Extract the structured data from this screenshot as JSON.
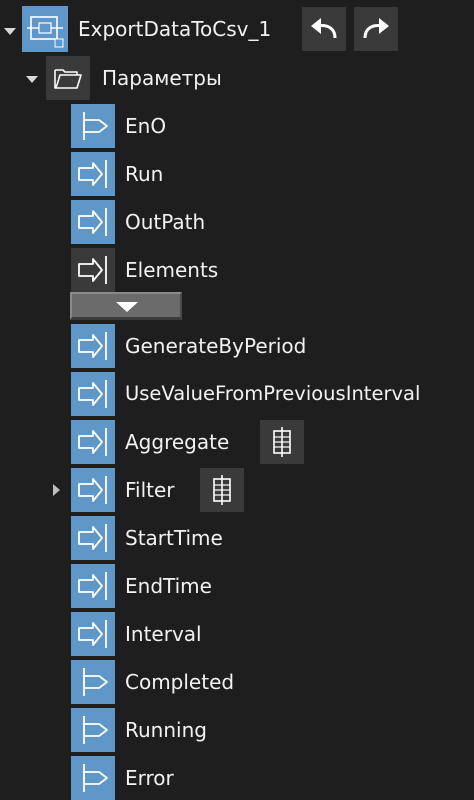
{
  "tree": {
    "root": {
      "label": "ExportDataToCsv_1",
      "icon": "function-block-icon",
      "undo_icon": "undo-arrow-icon",
      "redo_icon": "redo-arrow-icon"
    },
    "params_folder": {
      "label": "Параметры",
      "icon": "folder-open-icon"
    },
    "params": [
      {
        "label": "EnO",
        "kind": "output"
      },
      {
        "label": "Run",
        "kind": "input"
      },
      {
        "label": "OutPath",
        "kind": "input"
      },
      {
        "label": "Elements",
        "kind": "input-inactive"
      },
      {
        "label": "GenerateByPeriod",
        "kind": "input"
      },
      {
        "label": "UseValueFromPreviousInterval",
        "kind": "input"
      },
      {
        "label": "Aggregate",
        "kind": "input"
      },
      {
        "label": "Filter",
        "kind": "input"
      },
      {
        "label": "StartTime",
        "kind": "input"
      },
      {
        "label": "EndTime",
        "kind": "input"
      },
      {
        "label": "Interval",
        "kind": "input"
      },
      {
        "label": "Completed",
        "kind": "output"
      },
      {
        "label": "Running",
        "kind": "output"
      },
      {
        "label": "Error",
        "kind": "output"
      }
    ]
  },
  "colors": {
    "background": "#1e1e1e",
    "tile_blue": "#5f97c9",
    "tile_gray": "#3a3a3a"
  }
}
